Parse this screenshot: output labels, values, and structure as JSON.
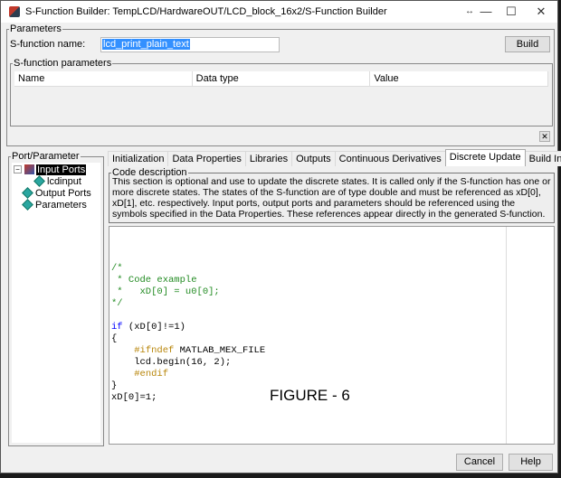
{
  "window": {
    "title": "S-Function Builder: TempLCD/HardwareOUT/LCD_block_16x2/S-Function Builder",
    "controls": [
      "↔",
      "—",
      "☐",
      "✕"
    ]
  },
  "parameters": {
    "label": "Parameters",
    "name_label": "S-function name:",
    "name_value": "lcd_print_plain_text",
    "build": "Build"
  },
  "sfparams": {
    "label": "S-function parameters",
    "columns": [
      "Name",
      "Data type",
      "Value"
    ],
    "close": "✕"
  },
  "tree": {
    "label": "Port/Parameter",
    "items": [
      "Input Ports",
      "lcdinput",
      "Output Ports",
      "Parameters"
    ]
  },
  "tabs": [
    "Initialization",
    "Data Properties",
    "Libraries",
    "Outputs",
    "Continuous Derivatives",
    "Discrete Update",
    "Build Info"
  ],
  "active_tab": "Discrete Update",
  "description": {
    "label": "Code description",
    "text": "This section is optional and use to update the discrete states. It is called only if the S-function has one or more discrete states. The states of the S-function are of type double and must be referenced as xD[0], xD[1], etc. respectively. Input ports, output ports and parameters should be referenced using the symbols specified in the Data Properties. These references appear directly in the generated S-function."
  },
  "code": [
    [
      {
        "t": "/*",
        "k": "cm"
      }
    ],
    [
      {
        "t": " * Code example",
        "k": "cm"
      }
    ],
    [
      {
        "t": " *   xD[0] = u0[0];",
        "k": "cm"
      }
    ],
    [
      {
        "t": "*/",
        "k": "cm"
      }
    ],
    [
      {
        "t": "",
        "k": "pl"
      }
    ],
    [
      {
        "t": "if",
        "k": "kw"
      },
      {
        "t": " (xD[0]!=1)",
        "k": "pl"
      }
    ],
    [
      {
        "t": "{",
        "k": "pl"
      }
    ],
    [
      {
        "t": "    ",
        "k": "pl"
      },
      {
        "t": "#ifndef",
        "k": "pp"
      },
      {
        "t": " MATLAB_MEX_FILE",
        "k": "pl"
      }
    ],
    [
      {
        "t": "    lcd.begin(16, 2);",
        "k": "pl"
      }
    ],
    [
      {
        "t": "    ",
        "k": "pl"
      },
      {
        "t": "#endif",
        "k": "pp"
      }
    ],
    [
      {
        "t": "}",
        "k": "pl"
      }
    ],
    [
      {
        "t": "xD[0]=1;",
        "k": "pl"
      }
    ]
  ],
  "figure_caption": "FIGURE - 6",
  "buttons": {
    "cancel": "Cancel",
    "help": "Help"
  }
}
